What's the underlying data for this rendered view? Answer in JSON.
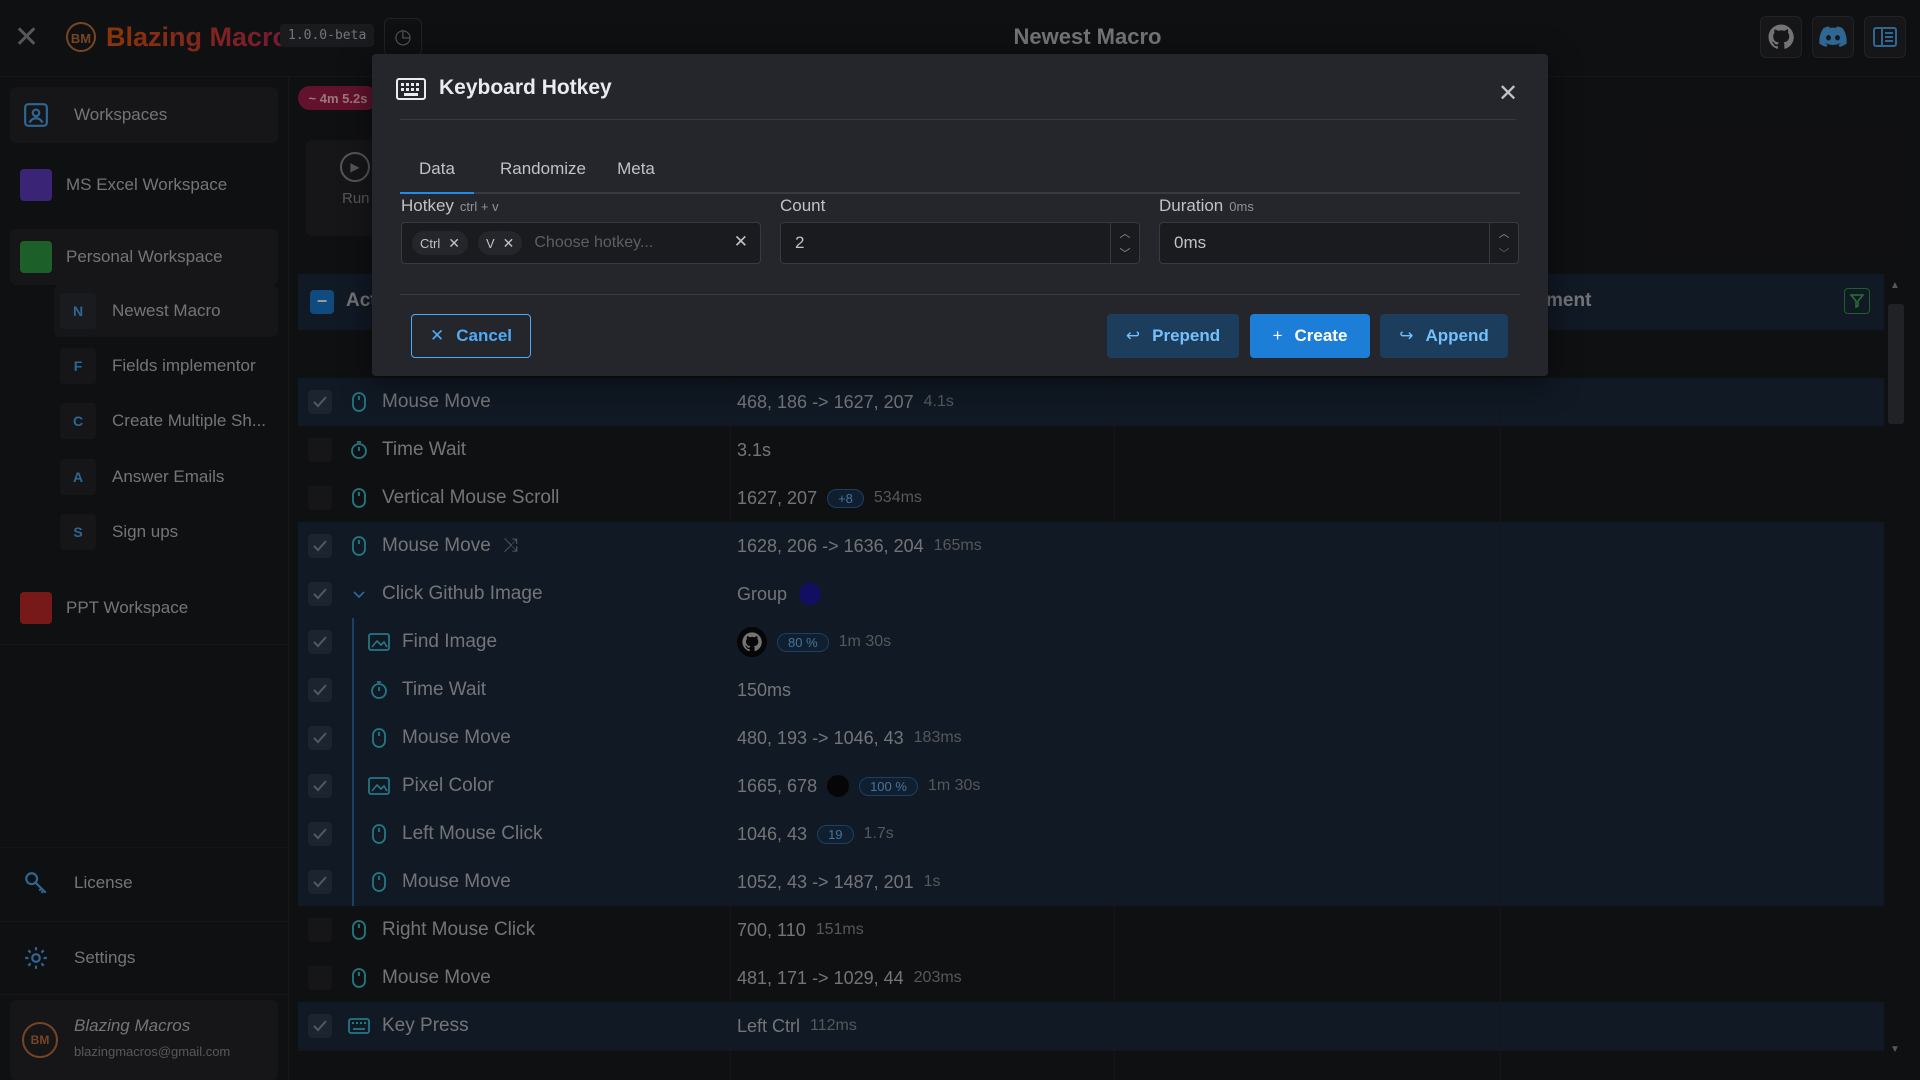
{
  "app": {
    "title": "Blazing Macros",
    "logo_text": "BM",
    "version": "1.0.0-beta",
    "window_title": "Newest Macro"
  },
  "sidebar": {
    "workspaces_label": "Workspaces",
    "workspaces": [
      {
        "label": "MS Excel Workspace",
        "color": "#5f3dc4"
      },
      {
        "label": "Personal Workspace",
        "color": "#2f9e44"
      },
      {
        "label": "PPT Workspace",
        "color": "#c92a2a"
      }
    ],
    "macros": [
      {
        "badge": "N",
        "label": "Newest Macro"
      },
      {
        "badge": "F",
        "label": "Fields implementor"
      },
      {
        "badge": "C",
        "label": "Create Multiple Sh..."
      },
      {
        "badge": "A",
        "label": "Answer Emails"
      },
      {
        "badge": "S",
        "label": "Sign ups"
      }
    ],
    "license_label": "License",
    "settings_label": "Settings",
    "user": {
      "name": "Blazing Macros",
      "email": "blazingmacros@gmail.com",
      "avatar_text": "BM"
    }
  },
  "toolbar": {
    "timer_badge": "~ 4m 5.2s",
    "run_label": "Run"
  },
  "table": {
    "header_left": "Act",
    "header_right": "ment",
    "rows": [
      {
        "name": "Mouse Move",
        "data": "468, 186 -> 1627, 207",
        "meta": "4.1s",
        "checked": true,
        "indent": false,
        "icon": "mouse-icon"
      },
      {
        "name": "Time Wait",
        "data": "3.1s",
        "meta": "",
        "checked": false,
        "indent": false,
        "icon": "timer-icon"
      },
      {
        "name": "Vertical Mouse Scroll",
        "data": "1627, 207",
        "pill": "+8",
        "meta": "534ms",
        "checked": false,
        "indent": false,
        "icon": "mouse-icon"
      },
      {
        "name": "Mouse Move",
        "data": "1628, 206 -> 1636, 204",
        "meta": "165ms",
        "checked": true,
        "indent": false,
        "icon": "mouse-icon",
        "shuffle": true
      },
      {
        "name": "Click Github Image",
        "data": "Group",
        "meta": "",
        "checked": true,
        "indent": false,
        "icon": "chevron-down-icon",
        "group_dot": true
      },
      {
        "name": "Find Image",
        "data": "",
        "pill": "80 %",
        "meta": "1m 30s",
        "checked": true,
        "indent": true,
        "icon": "image-icon",
        "thumb": true
      },
      {
        "name": "Time Wait",
        "data": "150ms",
        "meta": "",
        "checked": true,
        "indent": true,
        "icon": "timer-icon"
      },
      {
        "name": "Mouse Move",
        "data": "480, 193 -> 1046, 43",
        "meta": "183ms",
        "checked": true,
        "indent": true,
        "icon": "mouse-icon"
      },
      {
        "name": "Pixel Color",
        "data": "1665, 678",
        "pill": "100 %",
        "meta": "1m 30s",
        "checked": true,
        "indent": true,
        "icon": "image-icon",
        "color_dot": true
      },
      {
        "name": "Left Mouse Click",
        "data": "1046, 43",
        "pill": "19",
        "meta": "1.7s",
        "checked": true,
        "indent": true,
        "icon": "mouse-icon"
      },
      {
        "name": "Mouse Move",
        "data": "1052, 43 -> 1487, 201",
        "meta": "1s",
        "checked": true,
        "indent": true,
        "icon": "mouse-icon"
      },
      {
        "name": "Right Mouse Click",
        "data": "700, 110",
        "meta": "151ms",
        "checked": false,
        "indent": false,
        "icon": "mouse-icon"
      },
      {
        "name": "Mouse Move",
        "data": "481, 171 -> 1029, 44",
        "meta": "203ms",
        "checked": false,
        "indent": false,
        "icon": "mouse-icon"
      },
      {
        "name": "Key Press",
        "data": "Left Ctrl",
        "meta": "112ms",
        "checked": true,
        "indent": false,
        "icon": "keyboard-icon"
      }
    ]
  },
  "modal": {
    "title": "Keyboard Hotkey",
    "tabs": [
      "Data",
      "Randomize",
      "Meta"
    ],
    "active_tab": "Data",
    "hotkey": {
      "label": "Hotkey",
      "hint": "ctrl + v",
      "chips": [
        "Ctrl",
        "V"
      ],
      "placeholder": "Choose hotkey..."
    },
    "count": {
      "label": "Count",
      "value": "2"
    },
    "duration": {
      "label": "Duration",
      "hint": "0ms",
      "value": "0ms"
    },
    "buttons": {
      "cancel": "Cancel",
      "prepend": "Prepend",
      "create": "Create",
      "append": "Append"
    }
  },
  "colors": {
    "accent": "#228be6",
    "brand_orange": "#e8590c",
    "timer_badge": "#c2255c"
  }
}
